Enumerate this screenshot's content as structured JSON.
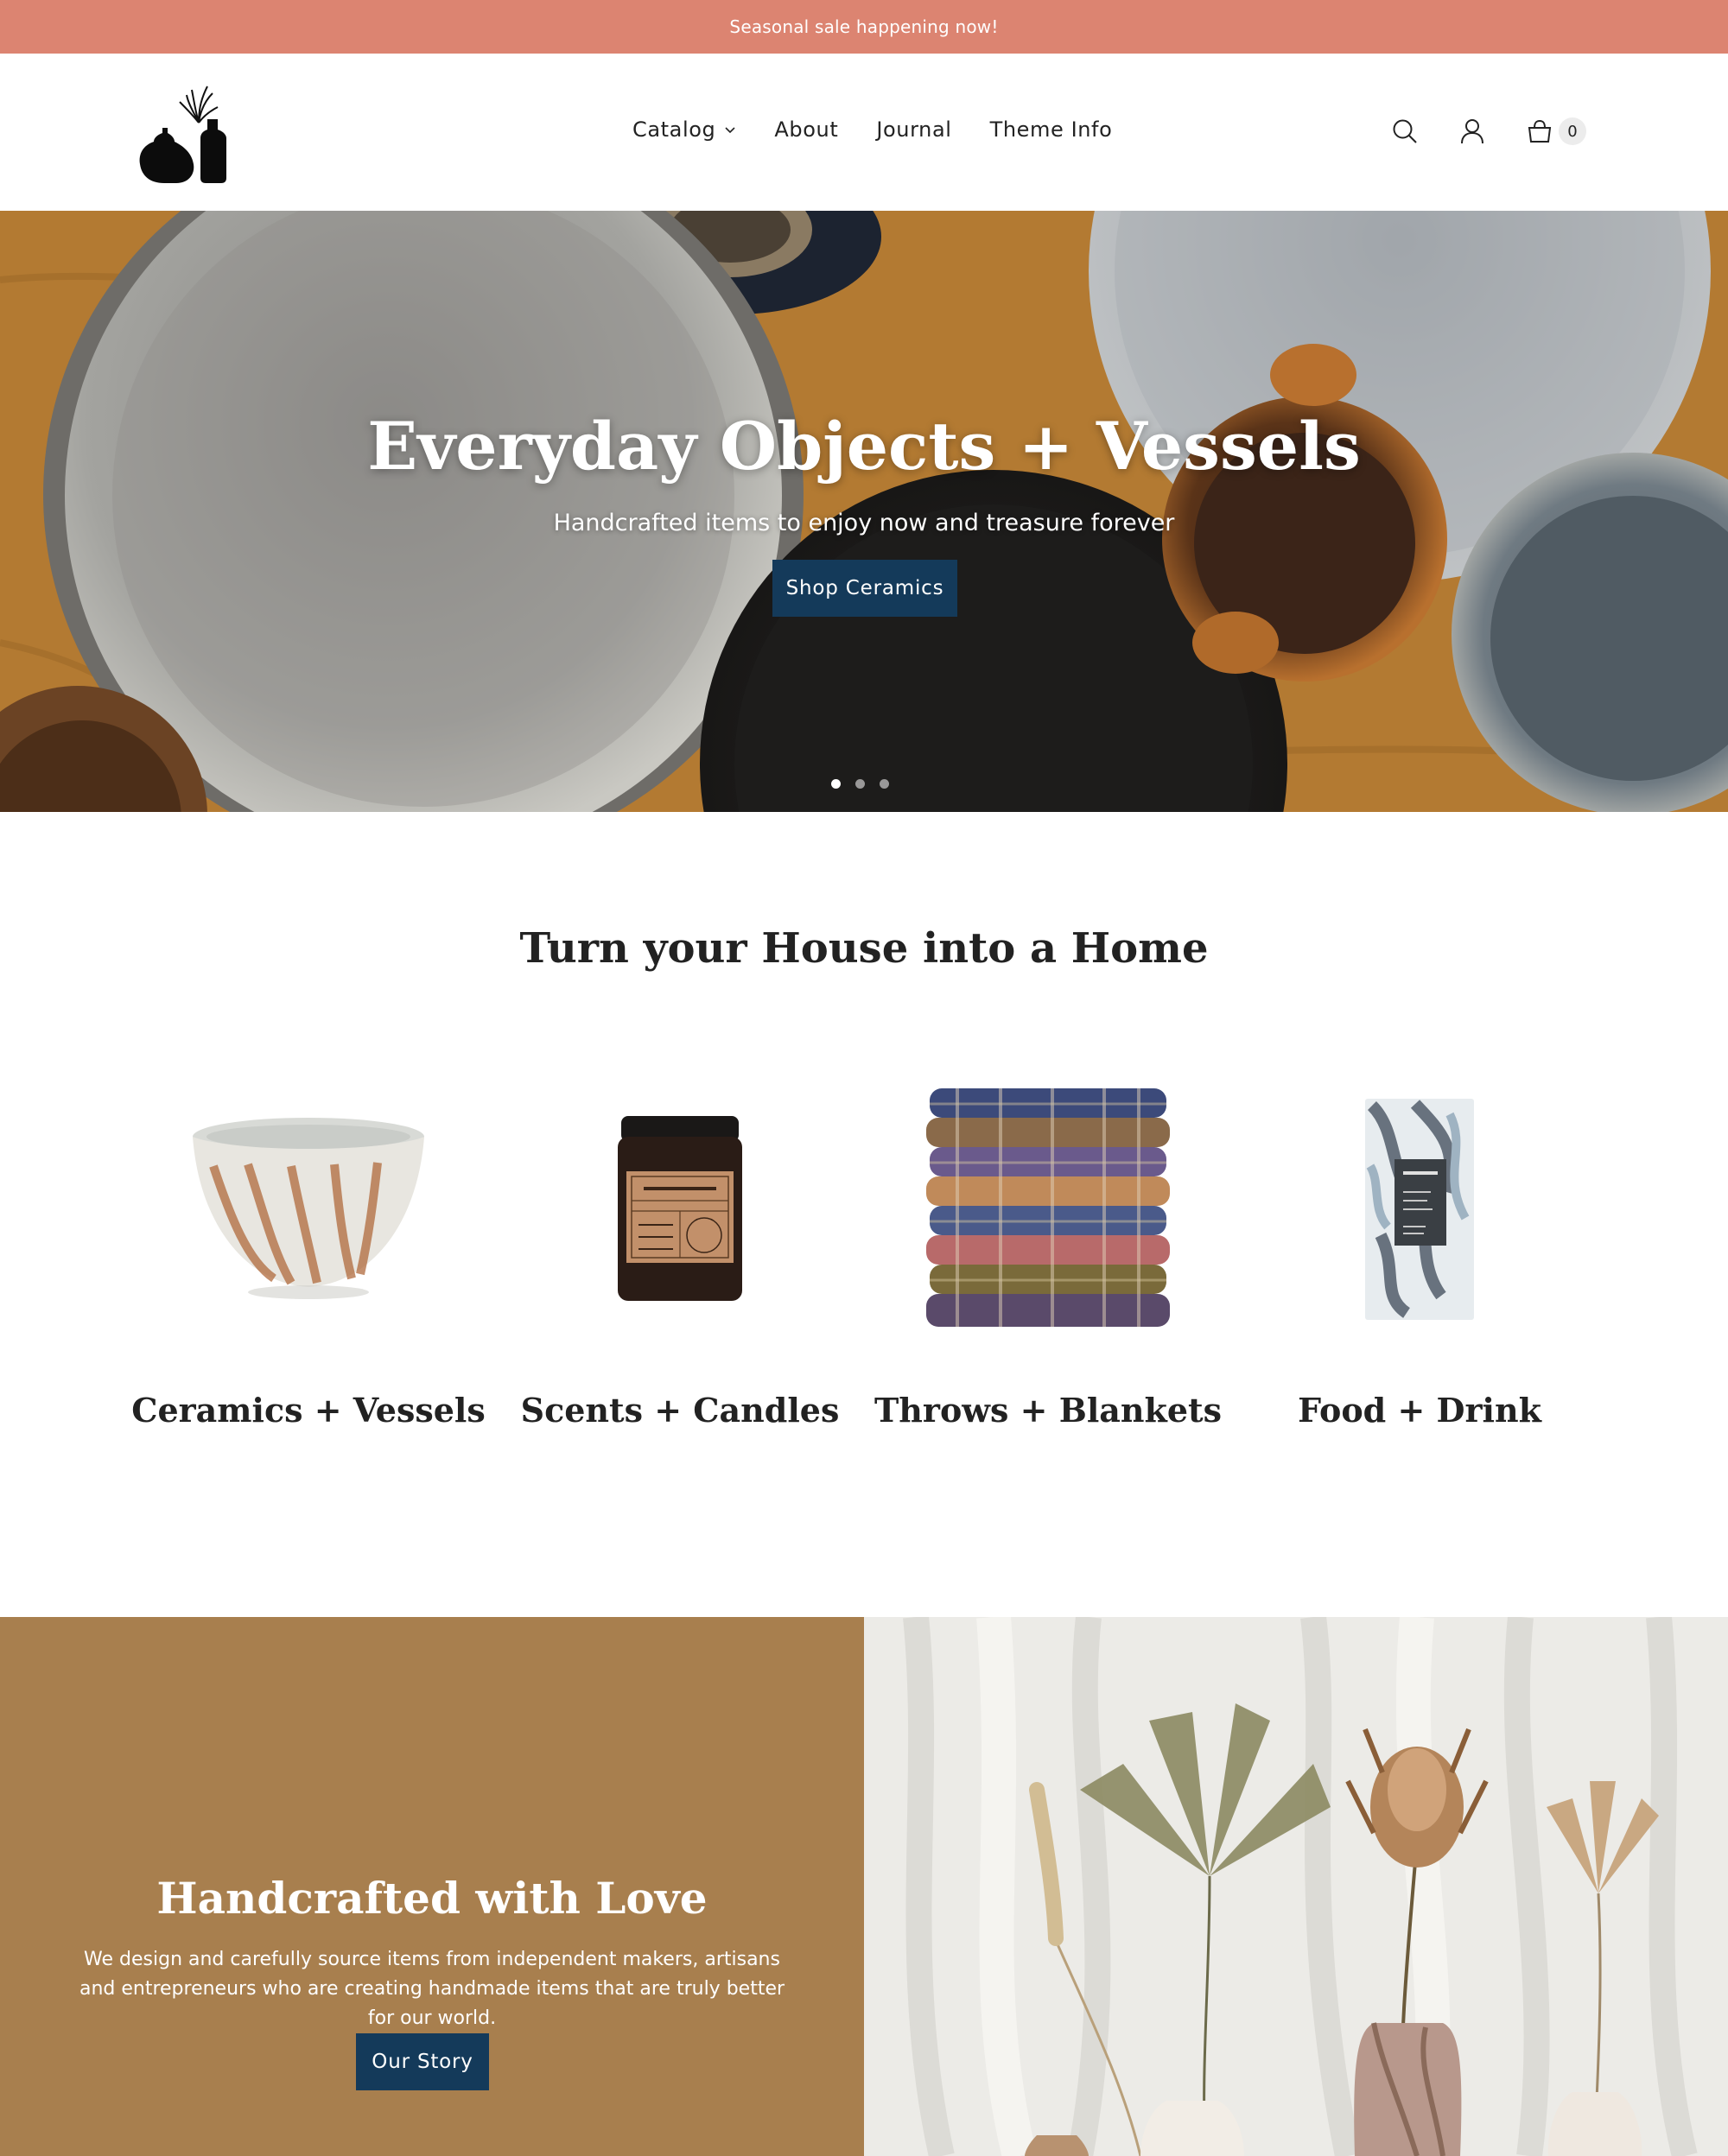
{
  "announcement": {
    "text": "Seasonal sale happening now!"
  },
  "header": {
    "nav": [
      {
        "label": "Catalog",
        "has_dropdown": true
      },
      {
        "label": "About"
      },
      {
        "label": "Journal"
      },
      {
        "label": "Theme Info"
      }
    ],
    "icons": [
      "search-icon",
      "account-icon",
      "cart-icon"
    ],
    "cart_count": "0"
  },
  "hero": {
    "title": "Everyday Objects + Vessels",
    "subtitle": "Handcrafted items to enjoy now and treasure forever",
    "button_label": "Shop Ceramics",
    "slides_total": 3,
    "active_slide": 1
  },
  "collections": {
    "title": "Turn your House into a Home",
    "items": [
      {
        "label": "Ceramics + Vessels"
      },
      {
        "label": "Scents + Candles"
      },
      {
        "label": "Throws + Blankets"
      },
      {
        "label": "Food + Drink"
      }
    ]
  },
  "story": {
    "title": "Handcrafted with Love",
    "text": "We design and carefully source items from independent makers, artisans and entrepreneurs who are creating handmade items that are truly better for our world.",
    "button_label": "Our Story"
  },
  "colors": {
    "announcement_bg": "#dc8471",
    "button_bg": "#143a5a",
    "story_bg": "#a87f4e"
  }
}
